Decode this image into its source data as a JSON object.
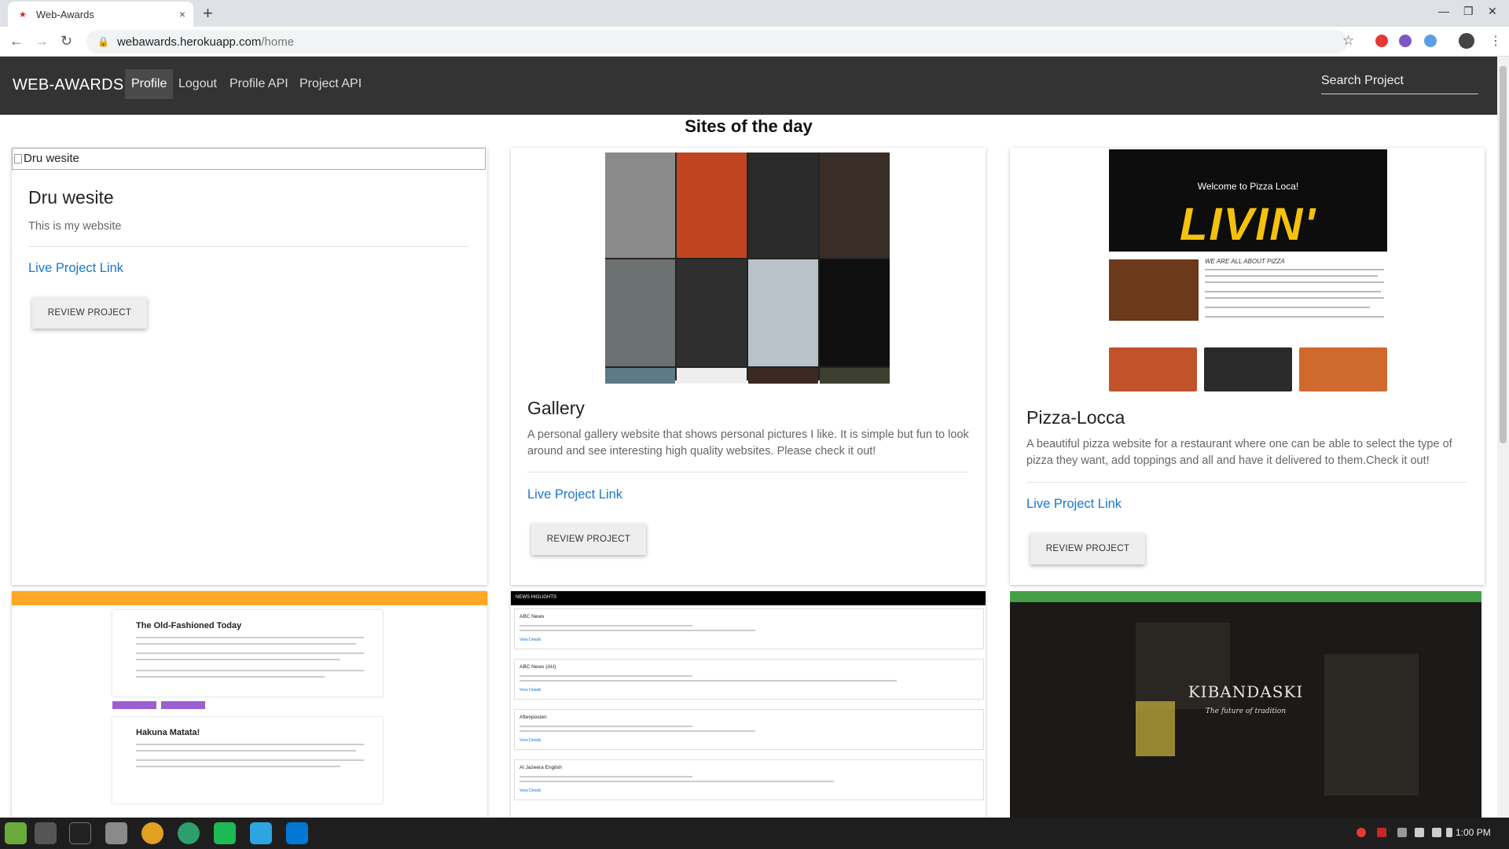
{
  "browser": {
    "tab_title": "Web-Awards",
    "url_host": "webawards.herokuapp.com",
    "url_path": "/home",
    "close_glyph": "×",
    "new_tab_glyph": "+"
  },
  "nav": {
    "brand": "WEB-AWARDS",
    "links": [
      "Profile",
      "Logout",
      "Profile API",
      "Project API"
    ],
    "search_placeholder": "Search Project"
  },
  "main": {
    "heading": "Sites of the day",
    "cards": [
      {
        "image_alt": "Dru wesite",
        "title": "Dru wesite",
        "description": "This is my website",
        "link": "Live Project Link",
        "button": "REVIEW PROJECT"
      },
      {
        "title": "Gallery",
        "description": "A personal gallery website that shows personal pictures I like. It is simple but fun to look around and see interesting high quality websites. Please check it out!",
        "link": "Live Project Link",
        "button": "REVIEW PROJECT"
      },
      {
        "title": "Pizza-Locca",
        "description": "A beautiful pizza website for a restaurant where one can be able to select the type of pizza they want, add toppings and all and have it delivered to them.Check it out!",
        "link": "Live Project Link",
        "button": "REVIEW PROJECT"
      }
    ],
    "previews": {
      "pizza_welcome": "Welcome to Pizza Loca!",
      "pizza_hero": "LIVIN'",
      "pizza_section": "WE ARE ALL ABOUT PIZZA",
      "blog_post_1": "The Old-Fashioned Today",
      "blog_post_2": "Hakuna Matata!",
      "news_brand": "NEWS HIGLIGHTS",
      "news_items": [
        "ABC News",
        "ABC News (AU)",
        "Aftenposten",
        "Al Jazeera English"
      ],
      "news_more": "View Details",
      "kibandaski_title": "KIBANDASKI",
      "kibandaski_tagline": "The future of tradition"
    }
  },
  "taskbar": {
    "time": "1:00 PM"
  },
  "colors": {
    "nav_bg": "#333333",
    "link": "#1976d2",
    "blog_bar": "#ffa726",
    "news_bar": "#000000",
    "kibandaski_bar": "#43a047"
  }
}
